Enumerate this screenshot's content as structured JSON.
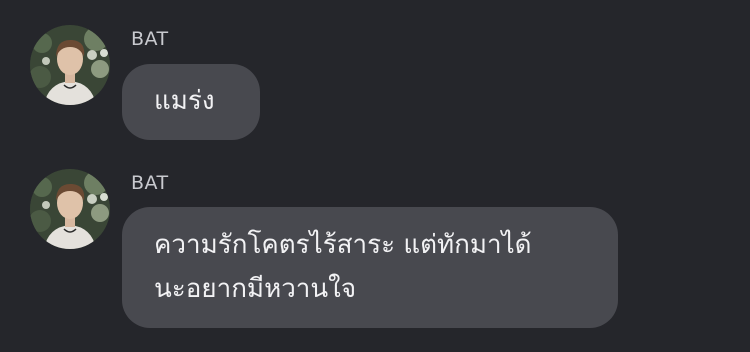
{
  "messages": [
    {
      "sender": "BAT",
      "avatar_icon": "profile-photo",
      "lines": [
        "แมร่ง"
      ]
    },
    {
      "sender": "BAT",
      "avatar_icon": "profile-photo",
      "lines": [
        "ความรักโคตรไร้สาระ แต่ทักมาได้",
        "นะอยากมีหวานใจ"
      ]
    }
  ],
  "colors": {
    "background": "#25262b",
    "bubble": "#48494f",
    "sender_text": "#c9cacf",
    "message_text": "#f2f2f4"
  }
}
